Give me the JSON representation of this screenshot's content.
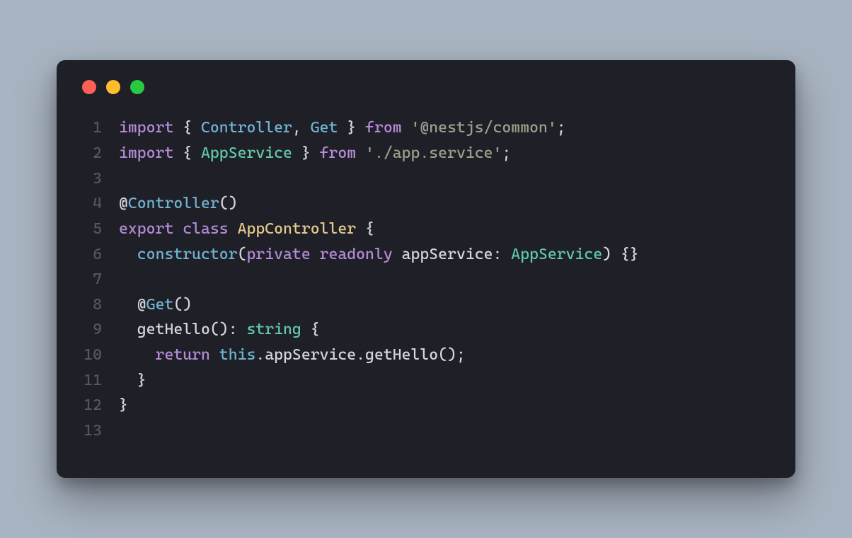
{
  "traffic_lights": {
    "red": "#ff5f56",
    "yellow": "#ffbd2e",
    "green": "#27c93f"
  },
  "code": {
    "lines": [
      {
        "num": "1",
        "tokens": [
          {
            "t": "import ",
            "c": "kw"
          },
          {
            "t": "{ ",
            "c": "punc"
          },
          {
            "t": "Controller",
            "c": "fn"
          },
          {
            "t": ", ",
            "c": "punc"
          },
          {
            "t": "Get",
            "c": "fn"
          },
          {
            "t": " } ",
            "c": "punc"
          },
          {
            "t": "from ",
            "c": "from"
          },
          {
            "t": "'@nestjs/common'",
            "c": "str"
          },
          {
            "t": ";",
            "c": "punc"
          }
        ]
      },
      {
        "num": "2",
        "tokens": [
          {
            "t": "import ",
            "c": "kw"
          },
          {
            "t": "{ ",
            "c": "punc"
          },
          {
            "t": "AppService",
            "c": "type"
          },
          {
            "t": " } ",
            "c": "punc"
          },
          {
            "t": "from ",
            "c": "from"
          },
          {
            "t": "'./app.service'",
            "c": "str"
          },
          {
            "t": ";",
            "c": "punc"
          }
        ]
      },
      {
        "num": "3",
        "tokens": []
      },
      {
        "num": "4",
        "tokens": [
          {
            "t": "@",
            "c": "punc"
          },
          {
            "t": "Controller",
            "c": "fn"
          },
          {
            "t": "()",
            "c": "punc"
          }
        ]
      },
      {
        "num": "5",
        "tokens": [
          {
            "t": "export ",
            "c": "kw"
          },
          {
            "t": "class ",
            "c": "kw"
          },
          {
            "t": "AppController",
            "c": "cls"
          },
          {
            "t": " {",
            "c": "punc"
          }
        ]
      },
      {
        "num": "6",
        "tokens": [
          {
            "t": "  ",
            "c": "punc"
          },
          {
            "t": "constructor",
            "c": "fn"
          },
          {
            "t": "(",
            "c": "punc"
          },
          {
            "t": "private ",
            "c": "kw"
          },
          {
            "t": "readonly ",
            "c": "kw"
          },
          {
            "t": "appService",
            "c": "ident"
          },
          {
            "t": ": ",
            "c": "punc"
          },
          {
            "t": "AppService",
            "c": "type"
          },
          {
            "t": ") {}",
            "c": "punc"
          }
        ]
      },
      {
        "num": "7",
        "tokens": []
      },
      {
        "num": "8",
        "tokens": [
          {
            "t": "  @",
            "c": "punc"
          },
          {
            "t": "Get",
            "c": "fn"
          },
          {
            "t": "()",
            "c": "punc"
          }
        ]
      },
      {
        "num": "9",
        "tokens": [
          {
            "t": "  ",
            "c": "punc"
          },
          {
            "t": "getHello",
            "c": "ident"
          },
          {
            "t": "(): ",
            "c": "punc"
          },
          {
            "t": "string",
            "c": "type"
          },
          {
            "t": " {",
            "c": "punc"
          }
        ]
      },
      {
        "num": "10",
        "tokens": [
          {
            "t": "    ",
            "c": "punc"
          },
          {
            "t": "return ",
            "c": "kw"
          },
          {
            "t": "this",
            "c": "fn"
          },
          {
            "t": ".",
            "c": "punc"
          },
          {
            "t": "appService",
            "c": "ident"
          },
          {
            "t": ".",
            "c": "punc"
          },
          {
            "t": "getHello",
            "c": "ident"
          },
          {
            "t": "();",
            "c": "punc"
          }
        ]
      },
      {
        "num": "11",
        "tokens": [
          {
            "t": "  }",
            "c": "punc"
          }
        ]
      },
      {
        "num": "12",
        "tokens": [
          {
            "t": "}",
            "c": "punc"
          }
        ]
      },
      {
        "num": "13",
        "tokens": []
      }
    ]
  }
}
